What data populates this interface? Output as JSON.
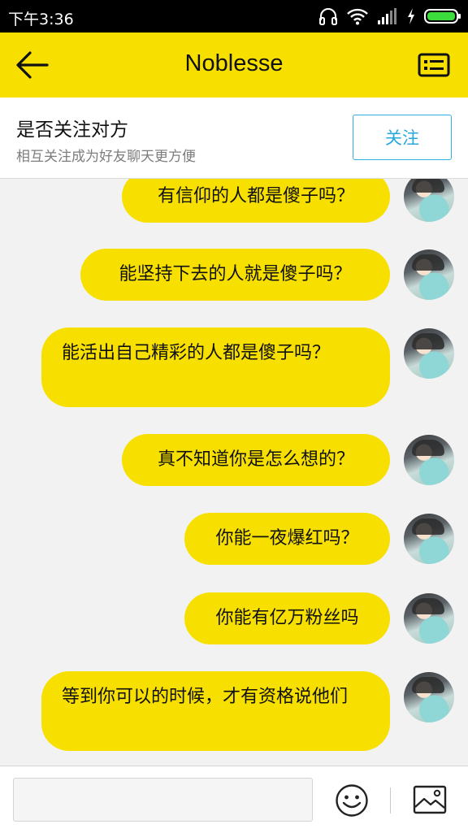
{
  "status_bar": {
    "time": "下午3:36",
    "icons": [
      "headphones-icon",
      "wifi-icon",
      "signal-icon",
      "charging-icon",
      "battery-icon"
    ],
    "battery_color": "#3ddc3d"
  },
  "header": {
    "title": "Noblesse",
    "background": "#f7e000"
  },
  "follow_prompt": {
    "title": "是否关注对方",
    "subtitle": "相互关注成为好友聊天更方便",
    "button_label": "关注",
    "button_color": "#27a8dc"
  },
  "messages": [
    {
      "text": "有信仰的人都是傻子吗？"
    },
    {
      "text": "能坚持下去的人就是傻子吗？"
    },
    {
      "text": "能活出自己精彩的人都是傻子吗？"
    },
    {
      "text": "真不知道你是怎么想的？"
    },
    {
      "text": "你能一夜爆红吗？"
    },
    {
      "text": "你能有亿万粉丝吗"
    },
    {
      "text": "等到你可以的时候，才有资格说他们"
    }
  ],
  "composer": {
    "value": "",
    "placeholder": "",
    "icons": [
      "emoji-icon",
      "image-icon"
    ]
  }
}
